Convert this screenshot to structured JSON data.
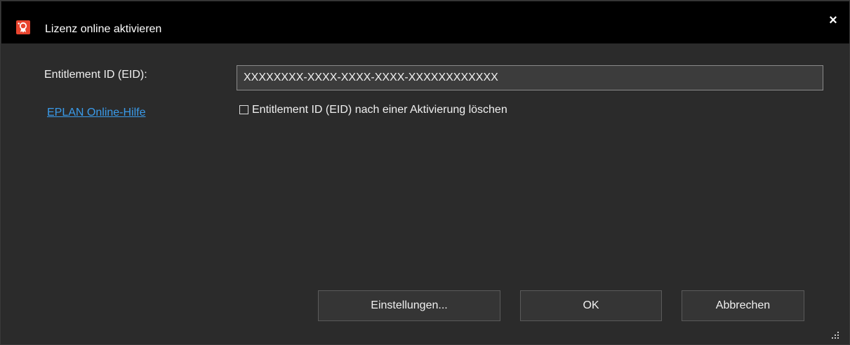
{
  "window": {
    "title": "Lizenz online aktivieren",
    "close_glyph": "×",
    "icon": "license-badge-icon"
  },
  "form": {
    "eid_label": "Entitlement ID (EID):",
    "eid_value": "XXXXXXXX-XXXX-XXXX-XXXX-XXXXXXXXXXXX",
    "help_link": "EPLAN Online-Hilfe",
    "delete_checkbox_label": "Entitlement ID (EID) nach einer Aktivierung löschen",
    "delete_checkbox_checked": false
  },
  "buttons": {
    "settings": "Einstellungen...",
    "ok": "OK",
    "cancel": "Abbrechen"
  },
  "colors": {
    "titlebar": "#000000",
    "background": "#2b2b2b",
    "accent_icon": "#e8452f",
    "link": "#3a9bea"
  }
}
